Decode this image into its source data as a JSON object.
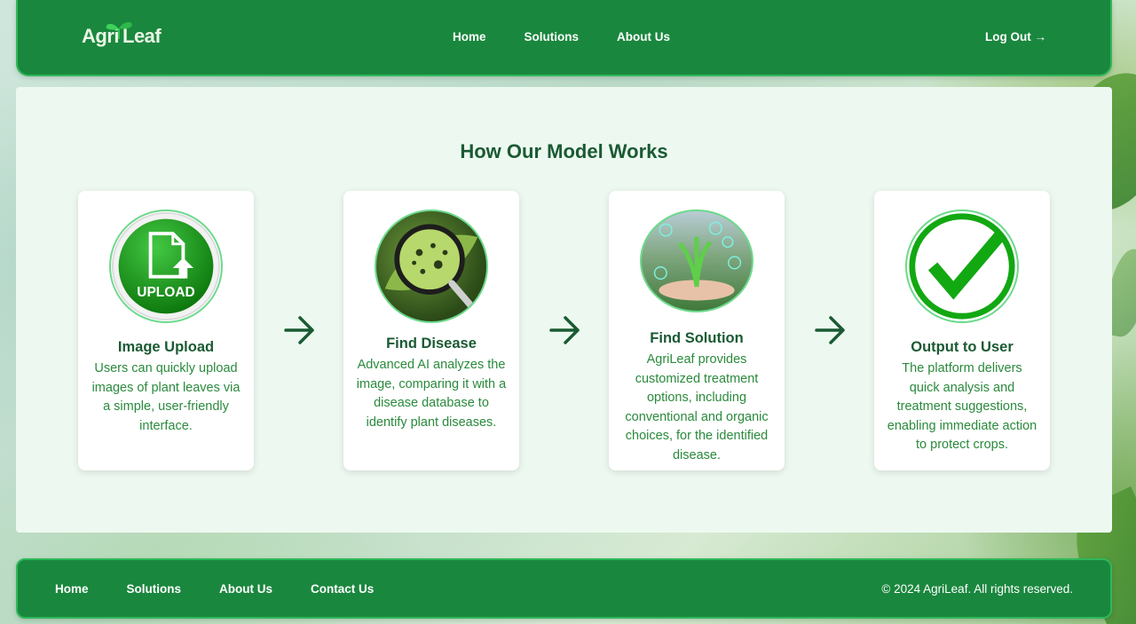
{
  "brand": {
    "name_part1": "Agri",
    "name_part2": "Leaf"
  },
  "header": {
    "nav": [
      "Home",
      "Solutions",
      "About Us"
    ],
    "logout": "Log Out →"
  },
  "main": {
    "title": "How Our Model Works",
    "steps": [
      {
        "title": "Image Upload",
        "description": "Users can quickly upload images of plant leaves via a simple, user-friendly interface.",
        "icon": "upload-icon",
        "icon_label": "UPLOAD"
      },
      {
        "title": "Find Disease",
        "description": "Advanced AI analyzes the image, comparing it with a disease database to identify plant diseases.",
        "icon": "magnifier-leaf-image"
      },
      {
        "title": "Find Solution",
        "description": "AgriLeaf provides customized treatment options, including conventional and organic choices, for the identified disease.",
        "icon": "sprout-in-hand-image"
      },
      {
        "title": "Output to User",
        "description": "The platform delivers quick analysis and treatment suggestions, enabling immediate action to protect crops.",
        "icon": "checkmark-icon"
      }
    ]
  },
  "footer": {
    "nav": [
      "Home",
      "Solutions",
      "About Us",
      "Contact Us"
    ],
    "copyright": "© 2024 AgriLeaf. All rights reserved."
  },
  "colors": {
    "primary_green": "#1a873e",
    "dark_green_text": "#1a5a33",
    "body_green_text": "#2a8a3c",
    "panel_bg": "#edf9f0"
  }
}
